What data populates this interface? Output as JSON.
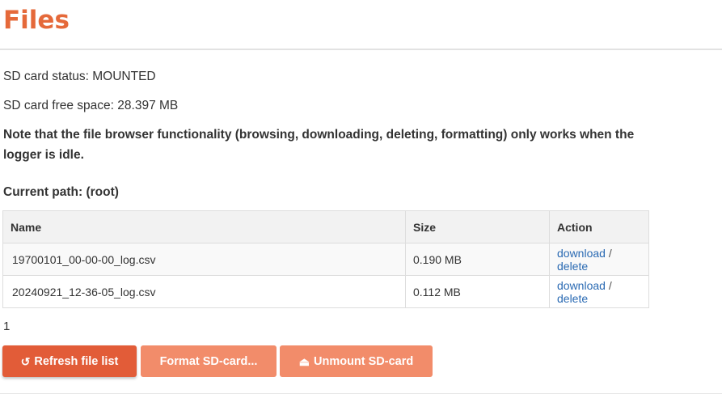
{
  "page": {
    "title": "Files"
  },
  "status": {
    "sd_status": "SD card status: MOUNTED",
    "free_space": "SD card free space: 28.397 MB",
    "note": "Note that the file browser functionality (browsing, downloading, deleting, formatting) only works when the logger is idle.",
    "current_path": "Current path: (root)"
  },
  "table": {
    "headers": {
      "name": "Name",
      "size": "Size",
      "action": "Action"
    },
    "rows": [
      {
        "name": "19700101_00-00-00_log.csv",
        "size": "0.190 MB",
        "download": "download",
        "sep": "/",
        "delete": "delete"
      },
      {
        "name": "20240921_12-36-05_log.csv",
        "size": "0.112 MB",
        "download": "download",
        "sep": "/",
        "delete": "delete"
      }
    ]
  },
  "pager": {
    "page": "1"
  },
  "buttons": {
    "refresh": {
      "icon": "↺",
      "icon_name": "refresh-icon",
      "label": "Refresh file list"
    },
    "format": {
      "label": "Format SD-card..."
    },
    "unmount": {
      "icon": "⏏",
      "icon_name": "eject-icon",
      "label": "Unmount SD-card"
    }
  },
  "colors": {
    "accent": "#e5693a",
    "primary_button": "#e25c38",
    "secondary_button": "#f28c6a",
    "link": "#2a6ab3"
  }
}
